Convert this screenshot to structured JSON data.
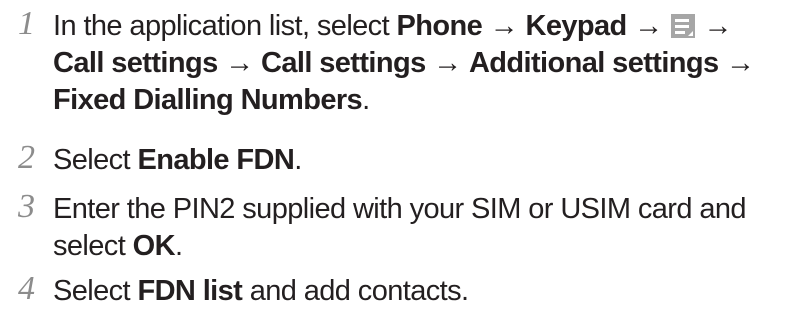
{
  "steps": [
    {
      "number": "1",
      "intro": "In the application list, select",
      "phone": "Phone",
      "arrow": "→",
      "keypad": "Keypad",
      "menu_icon": "menu-list-icon",
      "call_settings_1": "Call settings",
      "call_settings_2": "Call settings",
      "additional_settings": "Additional settings",
      "fdn_menu": "Fixed Dialling Numbers",
      "period": "."
    },
    {
      "number": "2",
      "intro": "Select",
      "enable_fdn": "Enable FDN",
      "period": "."
    },
    {
      "number": "3",
      "intro": "Enter the PIN2 supplied with your SIM or USIM card and select",
      "ok": "OK",
      "period": "."
    },
    {
      "number": "4",
      "intro": "Select",
      "fdn_list": "FDN list",
      "outro": "and add contacts."
    }
  ]
}
